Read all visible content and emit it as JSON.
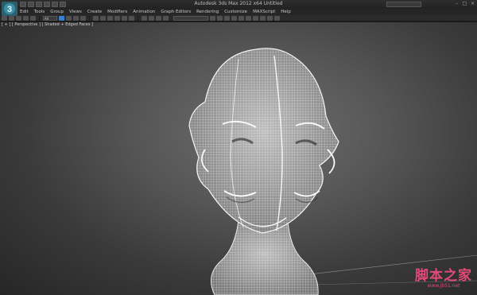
{
  "window": {
    "title": "Autodesk 3ds Max 2012 x64  Untitled"
  },
  "menu": [
    "Edit",
    "Tools",
    "Group",
    "Views",
    "Create",
    "Modifiers",
    "Animation",
    "Graph Editors",
    "Rendering",
    "Customize",
    "MAXScript",
    "Help"
  ],
  "toolbar": {
    "selection_filter": "All"
  },
  "viewport": {
    "label": "[ + ] [ Perspective ] [ Shaded + Edged Faces ]"
  },
  "watermark": {
    "title": "脚本之家",
    "url": "www.jb51.net"
  },
  "colors": {
    "wireframe": "#ffffff",
    "accent": "#3b7fd0",
    "watermark": "#e24a7a"
  }
}
